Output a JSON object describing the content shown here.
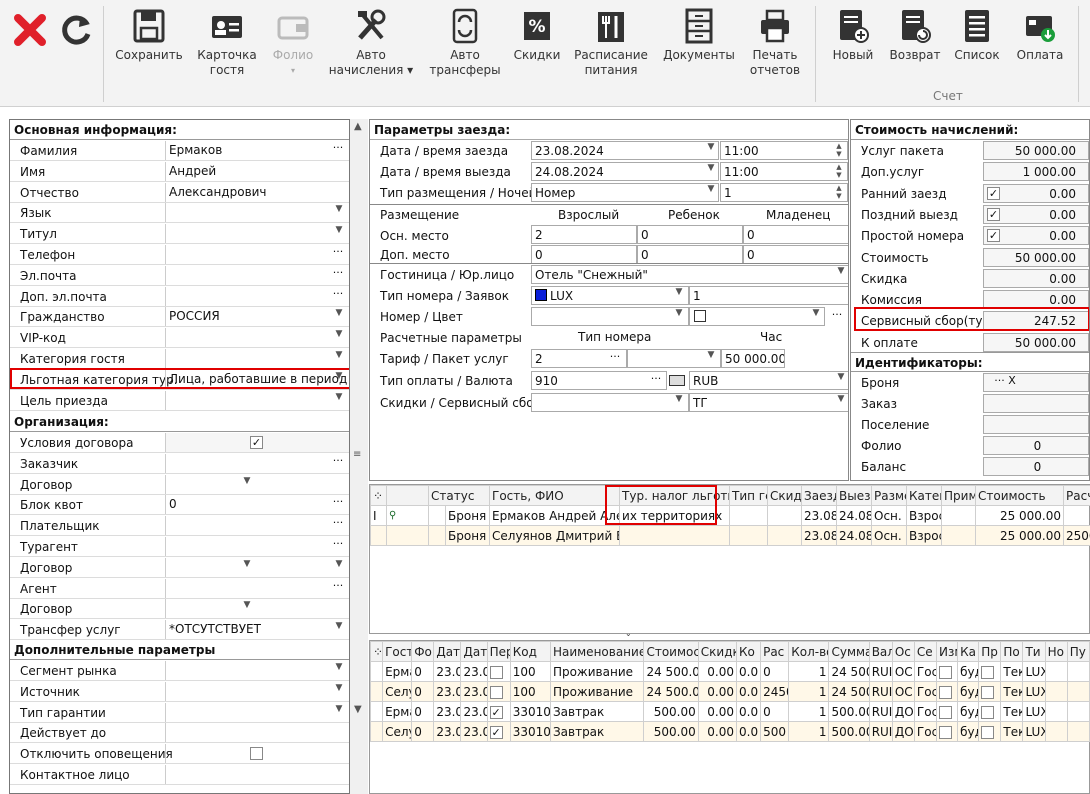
{
  "toolbar": {
    "buttons": [
      {
        "label": "Сохранить",
        "icon": "floppy-disk-icon"
      },
      {
        "label": "Карточка\nгостя",
        "icon": "id-card-icon"
      },
      {
        "label": "Фолио",
        "icon": "wallet-icon"
      },
      {
        "label": "Авто\nначисления ▾",
        "icon": "tools-icon"
      },
      {
        "label": "Авто\nтрансферы",
        "icon": "transfer-icon"
      },
      {
        "label": "Скидки",
        "icon": "percent-icon"
      },
      {
        "label": "Расписание\nпитания",
        "icon": "cutlery-icon"
      },
      {
        "label": "Документы",
        "icon": "cabinet-icon"
      },
      {
        "label": "Печать\nотчетов",
        "icon": "printer-icon"
      },
      {
        "label": "Новый",
        "icon": "new-invoice-icon"
      },
      {
        "label": "Возврат",
        "icon": "return-invoice-icon"
      },
      {
        "label": "Список",
        "icon": "list-icon"
      },
      {
        "label": "Оплата",
        "icon": "payment-icon"
      }
    ],
    "group_label": "Счет"
  },
  "left": {
    "main_title": "Основная информация:",
    "rows": [
      {
        "label": "Фамилия",
        "value": "Ермаков"
      },
      {
        "label": "Имя",
        "value": "Андрей"
      },
      {
        "label": "Отчество",
        "value": "Александрович"
      },
      {
        "label": "Язык",
        "value": ""
      },
      {
        "label": "Титул",
        "value": ""
      },
      {
        "label": "Телефон",
        "value": ""
      },
      {
        "label": "Эл.почта",
        "value": ""
      },
      {
        "label": "Доп. эл.почта",
        "value": ""
      },
      {
        "label": "Гражданство",
        "value": "РОССИЯ"
      },
      {
        "label": "VIP-код",
        "value": ""
      },
      {
        "label": "Категория гостя",
        "value": ""
      },
      {
        "label": "Льготная категория тур.",
        "value": "Лица, работавшие в период В"
      },
      {
        "label": "Цель приезда",
        "value": ""
      }
    ],
    "org_title": "Организация:",
    "org_rows": [
      {
        "label": "Условия договора",
        "value": ""
      },
      {
        "label": "Заказчик",
        "value": ""
      },
      {
        "label": "Договор",
        "value": ""
      },
      {
        "label": "Блок квот",
        "value": "0"
      },
      {
        "label": "Плательщик",
        "value": ""
      },
      {
        "label": "Турагент",
        "value": ""
      },
      {
        "label": "Договор",
        "value": ""
      },
      {
        "label": "Агент",
        "value": ""
      },
      {
        "label": "Договор",
        "value": ""
      },
      {
        "label": "Трансфер услуг",
        "value": "*ОТСУТСТВУЕТ"
      }
    ],
    "extra_title": "Дополнительные параметры",
    "extra_rows": [
      {
        "label": "Сегмент рынка",
        "value": ""
      },
      {
        "label": "Источник",
        "value": ""
      },
      {
        "label": "Тип гарантии",
        "value": ""
      },
      {
        "label": "Действует до",
        "value": ""
      },
      {
        "label": "Отключить оповещения",
        "value": ""
      },
      {
        "label": "Контактное лицо",
        "value": ""
      }
    ]
  },
  "stay": {
    "title": "Параметры заезда:",
    "checkin_label": "Дата / время заезда",
    "checkin_date": "23.08.2024",
    "checkin_time": "11:00",
    "checkout_label": "Дата / время выезда",
    "checkout_date": "24.08.2024",
    "checkout_time": "11:00",
    "type_label": "Тип размещения / Ночей",
    "type_value": "Номер",
    "nights": "1",
    "place_label": "Размещение",
    "col_adult": "Взрослый",
    "col_child": "Ребенок",
    "col_infant": "Младенец",
    "main_label": "Осн. место",
    "main_adult": "2",
    "main_child": "0",
    "main_infant": "0",
    "add_label": "Доп. место",
    "add_adult": "0",
    "add_child": "0",
    "add_infant": "0",
    "hotel_label": "Гостиница / Юр.лицо",
    "hotel_value": "Отель \"Снежный\"",
    "roomtype_label": "Тип номера / Заявок",
    "roomtype_value": "LUX",
    "roomtype_count": "1",
    "room_label": "Номер / Цвет",
    "calc_label": "Расчетные параметры",
    "col_roomtype": "Тип номера",
    "col_hour": "Час",
    "tariff_label": "Тариф / Пакет услуг",
    "tariff_value": "2",
    "tariff_amount": "50 000.00",
    "paytype_label": "Тип оплаты / Валюта",
    "paytype_value": "910",
    "currency": "RUB",
    "discount_label": "Скидки / Сервисный сбор(",
    "discount_value": "ТГ"
  },
  "cost": {
    "title": "Стоимость начислений:",
    "rows": [
      {
        "label": "Услуг пакета",
        "value": "50 000.00",
        "check": false
      },
      {
        "label": "Доп.услуг",
        "value": "1 000.00",
        "check": false
      },
      {
        "label": "Ранний заезд",
        "value": "0.00",
        "check": true
      },
      {
        "label": "Поздний выезд",
        "value": "0.00",
        "check": true
      },
      {
        "label": "Простой номера",
        "value": "0.00",
        "check": true
      },
      {
        "label": "Стоимость",
        "value": "50 000.00",
        "check": false
      },
      {
        "label": "Скидка",
        "value": "0.00",
        "check": false
      },
      {
        "label": "Комиссия",
        "value": "0.00",
        "check": false
      },
      {
        "label": "Сервисный сбор(тур.",
        "value": "247.52",
        "check": false
      },
      {
        "label": "К оплате",
        "value": "50 000.00",
        "check": false
      }
    ],
    "id_title": "Идентификаторы:",
    "id_rows": [
      {
        "label": "Броня",
        "value": ""
      },
      {
        "label": "Заказ",
        "value": ""
      },
      {
        "label": "Поселение",
        "value": ""
      },
      {
        "label": "Фолио",
        "value": "0"
      },
      {
        "label": "Баланс",
        "value": "0"
      }
    ]
  },
  "guests": {
    "headers": [
      "Статус",
      "Гость, ФИО",
      "Тур. налог льготная",
      "Тип гс",
      "Скид",
      "Заезд",
      "Выезд",
      "Разме",
      "Катег",
      "Приме",
      "Стоимость",
      "Расче"
    ],
    "rows": [
      [
        "Броня",
        "Ермаков Андрей Алекс",
        "их территориях",
        "",
        "",
        "23.08",
        "24.08",
        "Осн. м",
        "Взрос",
        "",
        "25 000.00",
        "0"
      ],
      [
        "Броня",
        "Селуянов Дмитрий Вла",
        "",
        "",
        "",
        "23.08",
        "24.08",
        "Осн. м",
        "Взрос",
        "",
        "25 000.00",
        "25000"
      ]
    ]
  },
  "charges": {
    "headers": [
      "Гост",
      "Фо.",
      "Дат",
      "Дат",
      "Пер",
      "Код",
      "Наименование у",
      "Стоимост",
      "Скидк",
      "Ко",
      "Рас",
      "Кол-во",
      "Сумма",
      "Вал",
      "Ос",
      "Се",
      "Изм",
      "Ка",
      "Пр",
      "По",
      "Ти",
      "Но",
      "Пу"
    ],
    "rows": [
      [
        "Ерма",
        "0",
        "23.0",
        "23.0",
        "",
        "100",
        "Проживание",
        "24 500.00",
        "0.00",
        "0.0",
        "0",
        "1",
        "24 500",
        "RUI",
        "ОС",
        "Гос",
        "",
        "буд",
        "",
        "Тек",
        "LUX",
        "",
        ""
      ],
      [
        "Селу",
        "0",
        "23.0",
        "23.0",
        "",
        "100",
        "Проживание",
        "24 500.00",
        "0.00",
        "0.0",
        "2450",
        "1",
        "24 500",
        "RUI",
        "ОС",
        "Гос",
        "",
        "буд",
        "",
        "Тек",
        "LUX",
        "",
        ""
      ],
      [
        "Ерма",
        "0",
        "23.0",
        "23.0",
        "✓",
        "33010",
        "Завтрак",
        "500.00",
        "0.00",
        "0.0",
        "0",
        "1",
        "500.00",
        "RUI",
        "ДО",
        "Гос",
        "",
        "буд",
        "",
        "Тек",
        "LUX",
        "",
        ""
      ],
      [
        "Селу",
        "0",
        "23.0",
        "23.0",
        "✓",
        "33010",
        "Завтрак",
        "500.00",
        "0.00",
        "0.0",
        "500",
        "1",
        "500.00",
        "RUI",
        "ДО",
        "Гос",
        "",
        "буд",
        "",
        "Тек",
        "LUX",
        "",
        ""
      ]
    ]
  }
}
